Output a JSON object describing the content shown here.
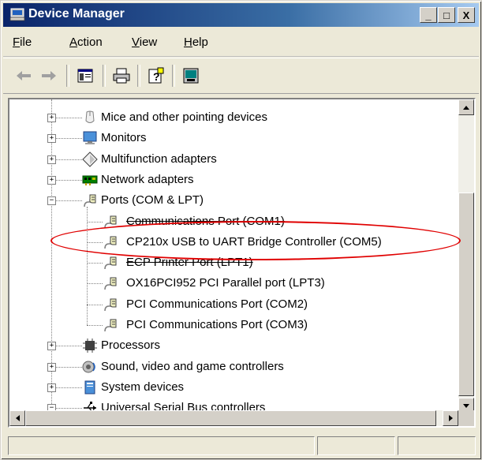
{
  "window": {
    "title": "Device Manager"
  },
  "title_buttons": {
    "minimize": "_",
    "maximize": "□",
    "close": "X"
  },
  "menu": [
    {
      "label": "File",
      "underline": "F",
      "rest": "ile"
    },
    {
      "label": "Action",
      "underline": "A",
      "rest": "ction"
    },
    {
      "label": "View",
      "underline": "V",
      "rest": "iew"
    },
    {
      "label": "Help",
      "underline": "H",
      "rest": "elp"
    }
  ],
  "toolbar": {
    "icons": [
      "back-arrow-icon",
      "forward-arrow-icon",
      "properties-icon",
      "print-icon",
      "help-icon",
      "update-driver-icon"
    ]
  },
  "tree": {
    "items": [
      {
        "label": "Mice and other pointing devices",
        "expander": "+",
        "icon": "mouse-icon"
      },
      {
        "label": "Monitors",
        "expander": "+",
        "icon": "monitor-icon"
      },
      {
        "label": "Multifunction adapters",
        "expander": "+",
        "icon": "multifunction-icon"
      },
      {
        "label": "Network adapters",
        "expander": "+",
        "icon": "network-adapter-icon"
      },
      {
        "label": "Ports (COM & LPT)",
        "expander": "−",
        "icon": "port-icon"
      },
      {
        "label": "Communications Port (COM1)",
        "icon": "port-icon",
        "child": true,
        "strikethrough": true
      },
      {
        "label": "CP210x USB to UART Bridge Controller (COM5)",
        "icon": "port-icon",
        "child": true,
        "highlighted": true
      },
      {
        "label": "ECP Printer Port (LPT1)",
        "icon": "port-icon",
        "child": true,
        "strikethrough": true
      },
      {
        "label": "OX16PCI952 PCI Parallel port (LPT3)",
        "icon": "port-icon",
        "child": true
      },
      {
        "label": "PCI Communications Port (COM2)",
        "icon": "port-icon",
        "child": true
      },
      {
        "label": "PCI Communications Port (COM3)",
        "icon": "port-icon",
        "child": true
      },
      {
        "label": "Processors",
        "expander": "+",
        "icon": "processor-icon"
      },
      {
        "label": "Sound, video and game controllers",
        "expander": "+",
        "icon": "sound-icon"
      },
      {
        "label": "System devices",
        "expander": "+",
        "icon": "system-device-icon"
      },
      {
        "label": "Universal Serial Bus controllers",
        "expander": "−",
        "icon": "usb-icon"
      }
    ]
  },
  "colors": {
    "title_start": "#0a246a",
    "title_end": "#a6caf0",
    "highlight_ellipse": "#e00000"
  },
  "statusbar": {
    "panels": [
      "",
      "",
      ""
    ]
  }
}
